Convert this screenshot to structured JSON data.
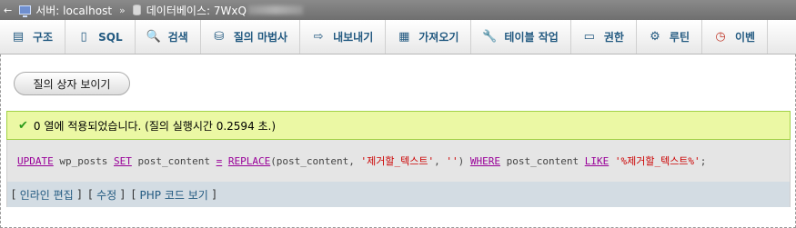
{
  "breadcrumb": {
    "back_glyph": "←",
    "server_label": "서버: localhost",
    "separator": "»",
    "database_label": "데이터베이스: 7WxQ"
  },
  "tabs": [
    {
      "label": "구조",
      "icon": "structure-icon",
      "glyph": "▤"
    },
    {
      "label": "SQL",
      "icon": "sql-icon",
      "glyph": "▯"
    },
    {
      "label": "검색",
      "icon": "search-icon",
      "glyph": "🔍"
    },
    {
      "label": "질의 마법사",
      "icon": "query-icon",
      "glyph": "⛁"
    },
    {
      "label": "내보내기",
      "icon": "export-icon",
      "glyph": "⇨"
    },
    {
      "label": "가져오기",
      "icon": "import-icon",
      "glyph": "▦"
    },
    {
      "label": "테이블 작업",
      "icon": "wrench-icon",
      "glyph": "🔧"
    },
    {
      "label": "권한",
      "icon": "privileges-icon",
      "glyph": "▭"
    },
    {
      "label": "루틴",
      "icon": "routines-icon",
      "glyph": "⚙"
    },
    {
      "label": "이벤",
      "icon": "events-icon",
      "glyph": "◷"
    }
  ],
  "query_box_button": "질의 상자 보이기",
  "success": {
    "check_glyph": "✔",
    "message": "0 열에 적용되었습니다. (질의 실행시간 0.2594 초.)"
  },
  "sql": {
    "kw_update": "UPDATE",
    "table": " wp_posts ",
    "kw_set": "SET",
    "col1": " post_content ",
    "op_eq": "=",
    "sp1": " ",
    "fn_replace": "REPLACE",
    "args": "(post_content, ",
    "str1": "'제거할_텍스트'",
    "comma": ", ",
    "str2": "''",
    "close": ") ",
    "kw_where": "WHERE",
    "col2": " post_content ",
    "kw_like": "LIKE",
    "sp2": " ",
    "str3": "'%제거할_텍스트%'",
    "end": ";"
  },
  "links": {
    "inline_edit": "인라인 편집",
    "edit": "수정",
    "php_code": "PHP 코드 보기"
  },
  "colors": {
    "success_bg": "#ebf8a4",
    "sql_bg": "#e5e5e5",
    "links_bg": "#d3dce3",
    "keyword": "#990099",
    "string": "#cc0000",
    "tab_text": "#235a81"
  }
}
